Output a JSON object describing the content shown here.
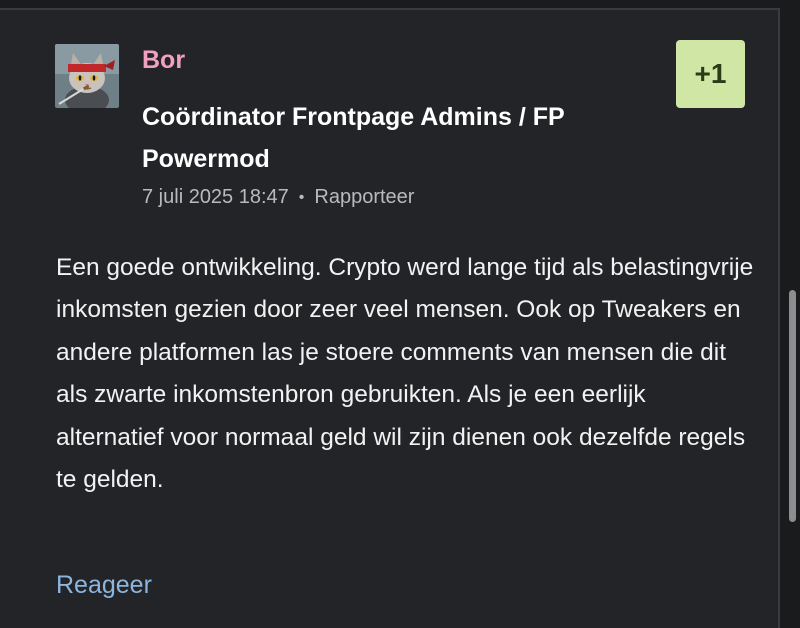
{
  "comment": {
    "author": "Bor",
    "role": "Coördinator Frontpage Admins / FP Powermod",
    "timestamp": "7 juli 2025 18:47",
    "separator": "•",
    "report_label": "Rapporteer",
    "score": "+1",
    "body": "Een goede ontwikkeling. Crypto werd lange tijd als belastingvrije inkomsten gezien door zeer veel mensen. Ook op Tweakers en andere platformen las je stoere comments van mensen die dit als zwarte inkomstenbron gebruikten. Als je een eerlijk alternatief voor normaal geld wil zijn dienen ook dezelfde regels te gelden.",
    "reply_label": "Reageer"
  },
  "avatar": {
    "icon": "ninja-cat-avatar"
  },
  "colors": {
    "background": "#1a1b1d",
    "card": "#232427",
    "author": "#f2a0c0",
    "score_badge": "#cfe6a5",
    "link": "#8ab6e0"
  }
}
